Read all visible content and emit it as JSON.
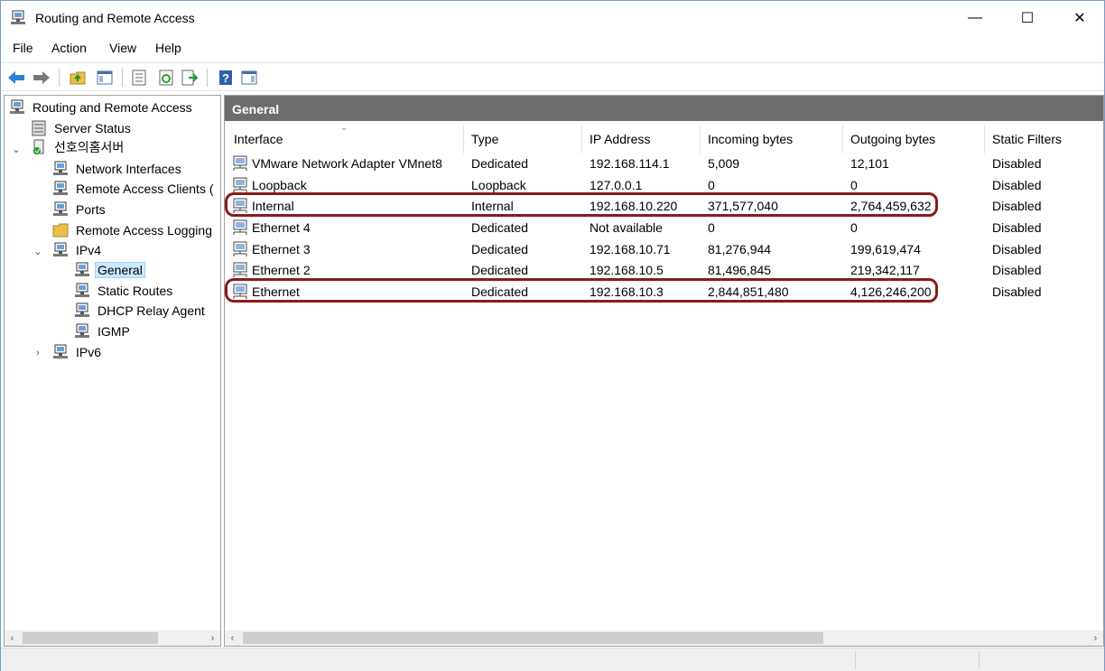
{
  "window": {
    "title": "Routing and Remote Access",
    "minimize_glyph": "—",
    "maximize_glyph": "☐",
    "close_glyph": "✕"
  },
  "menu": [
    "File",
    "Action",
    "View",
    "Help"
  ],
  "toolbar": {
    "buttons": [
      "back-icon",
      "forward-icon",
      "up-folder-icon",
      "show-hide-tree-icon",
      "properties-icon",
      "refresh-icon",
      "export-list-icon",
      "help-icon",
      "show-hide-action-pane-icon"
    ]
  },
  "tree": {
    "root": "Routing and Remote Access",
    "server_status": "Server Status",
    "server": "선호의홈서버",
    "network_interfaces": "Network Interfaces",
    "remote_access_clients": "Remote Access Clients (",
    "ports": "Ports",
    "remote_access_logging": "Remote Access Logging",
    "ipv4": "IPv4",
    "general": "General",
    "static_routes": "Static Routes",
    "dhcp_relay_agent": "DHCP Relay Agent",
    "igmp": "IGMP",
    "ipv6": "IPv6"
  },
  "detail": {
    "header": "General",
    "columns": [
      "Interface",
      "Type",
      "IP Address",
      "Incoming bytes",
      "Outgoing bytes",
      "Static Filters"
    ],
    "rows": [
      {
        "interface": "VMware Network Adapter VMnet8",
        "type": "Dedicated",
        "ip": "192.168.114.1",
        "incoming": "5,009",
        "outgoing": "12,101",
        "filters": "Disabled"
      },
      {
        "interface": "Loopback",
        "type": "Loopback",
        "ip": "127.0.0.1",
        "incoming": "0",
        "outgoing": "0",
        "filters": "Disabled"
      },
      {
        "interface": "Internal",
        "type": "Internal",
        "ip": "192.168.10.220",
        "incoming": "371,577,040",
        "outgoing": "2,764,459,632",
        "filters": "Disabled"
      },
      {
        "interface": "Ethernet 4",
        "type": "Dedicated",
        "ip": "Not available",
        "incoming": "0",
        "outgoing": "0",
        "filters": "Disabled"
      },
      {
        "interface": "Ethernet 3",
        "type": "Dedicated",
        "ip": "192.168.10.71",
        "incoming": "81,276,944",
        "outgoing": "199,619,474",
        "filters": "Disabled"
      },
      {
        "interface": "Ethernet 2",
        "type": "Dedicated",
        "ip": "192.168.10.5",
        "incoming": "81,496,845",
        "outgoing": "219,342,117",
        "filters": "Disabled"
      },
      {
        "interface": "Ethernet",
        "type": "Dedicated",
        "ip": "192.168.10.3",
        "incoming": "2,844,851,480",
        "outgoing": "4,126,246,200",
        "filters": "Disabled"
      }
    ],
    "highlighted_rows": [
      "Internal",
      "Ethernet"
    ],
    "highlight_color": "#8b1a1a"
  },
  "colors": {
    "pane_header_bg": "#6d6d6d",
    "selection_bg": "#cce8ff"
  }
}
